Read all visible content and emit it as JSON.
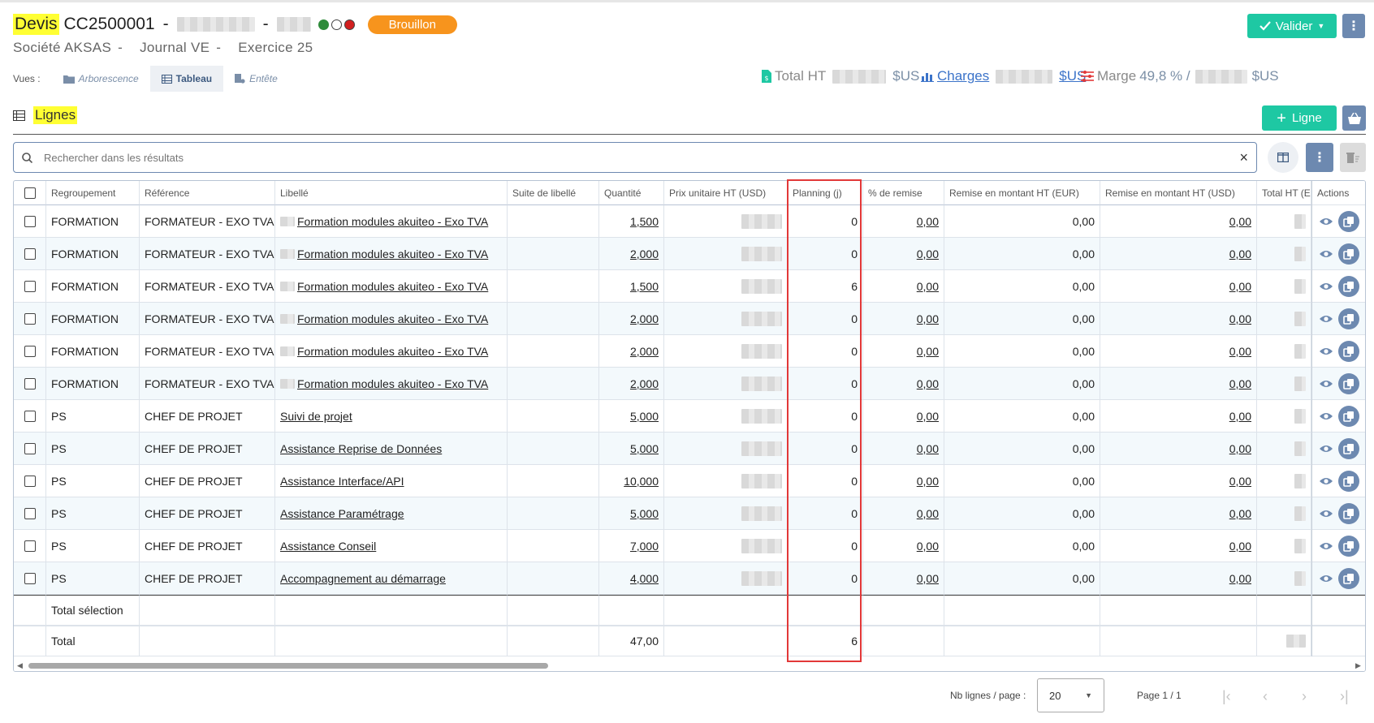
{
  "header": {
    "doc_type": "Devis",
    "doc_number": "CC2500001",
    "status_badge": "Brouillon",
    "status_dots": [
      "#2e8b3a",
      "#ffffff",
      "#d21f1f"
    ],
    "company": "Société AKSAS",
    "journal": "Journal VE",
    "exercise": "Exercice 25",
    "sep": "-",
    "validate_label": "Valider",
    "kebab": "⋮"
  },
  "views": {
    "label": "Vues :",
    "tabs": [
      {
        "label": "Arborescence",
        "active": false
      },
      {
        "label": "Tableau",
        "active": true
      },
      {
        "label": "Entête",
        "active": false
      }
    ]
  },
  "totals": {
    "total_ht_label": "Total HT",
    "charges_label": "Charges",
    "marge_label": "Marge",
    "marge_value": "49,8 % /",
    "currency": "$US"
  },
  "lines": {
    "title": "Lignes",
    "add_label": "Ligne",
    "search_placeholder": "Rechercher dans les résultats",
    "clear": "×",
    "columns": [
      "Regroupement",
      "Référence",
      "Libellé",
      "Suite de libellé",
      "Quantité",
      "Prix unitaire HT (USD)",
      "Planning (j)",
      "% de remise",
      "Remise en montant HT (EUR)",
      "Remise en montant HT (USD)",
      "Total HT (E",
      "Actions"
    ],
    "rows": [
      {
        "group": "FORMATION",
        "ref": "FORMATEUR - EXO TVA",
        "label": "Formation modules akuiteo - Exo TVA",
        "qty": "1,500",
        "planning": "0",
        "pct": "0,00",
        "eur": "0,00",
        "usd": "0,00"
      },
      {
        "group": "FORMATION",
        "ref": "FORMATEUR - EXO TVA",
        "label": "Formation modules akuiteo - Exo TVA",
        "qty": "2,000",
        "planning": "0",
        "pct": "0,00",
        "eur": "0,00",
        "usd": "0,00"
      },
      {
        "group": "FORMATION",
        "ref": "FORMATEUR - EXO TVA",
        "label": "Formation modules akuiteo - Exo TVA",
        "qty": "1,500",
        "planning": "6",
        "pct": "0,00",
        "eur": "0,00",
        "usd": "0,00"
      },
      {
        "group": "FORMATION",
        "ref": "FORMATEUR - EXO TVA",
        "label": "Formation modules akuiteo - Exo TVA",
        "qty": "2,000",
        "planning": "0",
        "pct": "0,00",
        "eur": "0,00",
        "usd": "0,00"
      },
      {
        "group": "FORMATION",
        "ref": "FORMATEUR - EXO TVA",
        "label": "Formation modules akuiteo - Exo TVA",
        "qty": "2,000",
        "planning": "0",
        "pct": "0,00",
        "eur": "0,00",
        "usd": "0,00"
      },
      {
        "group": "FORMATION",
        "ref": "FORMATEUR - EXO TVA",
        "label": "Formation modules akuiteo - Exo TVA",
        "qty": "2,000",
        "planning": "0",
        "pct": "0,00",
        "eur": "0,00",
        "usd": "0,00"
      },
      {
        "group": "PS",
        "ref": "CHEF DE PROJET",
        "label": "Suivi de projet",
        "qty": "5,000",
        "planning": "0",
        "pct": "0,00",
        "eur": "0,00",
        "usd": "0,00"
      },
      {
        "group": "PS",
        "ref": "CHEF DE PROJET",
        "label": "Assistance Reprise de Données",
        "qty": "5,000",
        "planning": "0",
        "pct": "0,00",
        "eur": "0,00",
        "usd": "0,00"
      },
      {
        "group": "PS",
        "ref": "CHEF DE PROJET",
        "label": "Assistance Interface/API",
        "qty": "10,000",
        "planning": "0",
        "pct": "0,00",
        "eur": "0,00",
        "usd": "0,00"
      },
      {
        "group": "PS",
        "ref": "CHEF DE PROJET",
        "label": "Assistance Paramétrage",
        "qty": "5,000",
        "planning": "0",
        "pct": "0,00",
        "eur": "0,00",
        "usd": "0,00"
      },
      {
        "group": "PS",
        "ref": "CHEF DE PROJET",
        "label": "Assistance Conseil",
        "qty": "7,000",
        "planning": "0",
        "pct": "0,00",
        "eur": "0,00",
        "usd": "0,00"
      },
      {
        "group": "PS",
        "ref": "CHEF DE PROJET",
        "label": "Accompagnement au démarrage",
        "qty": "4,000",
        "planning": "0",
        "pct": "0,00",
        "eur": "0,00",
        "usd": "0,00"
      }
    ],
    "total_selection_label": "Total sélection",
    "total_label": "Total",
    "total_qty": "47,00",
    "total_planning": "6"
  },
  "pagination": {
    "rows_per_page_label": "Nb lignes / page :",
    "rows_per_page": "20",
    "page_info": "Page 1 / 1"
  },
  "colors": {
    "accent": "#1ec8a3",
    "secondary": "#6d89b0",
    "badge": "#f7941d",
    "highlight": "#ffff33",
    "planning_frame": "#e23838"
  }
}
